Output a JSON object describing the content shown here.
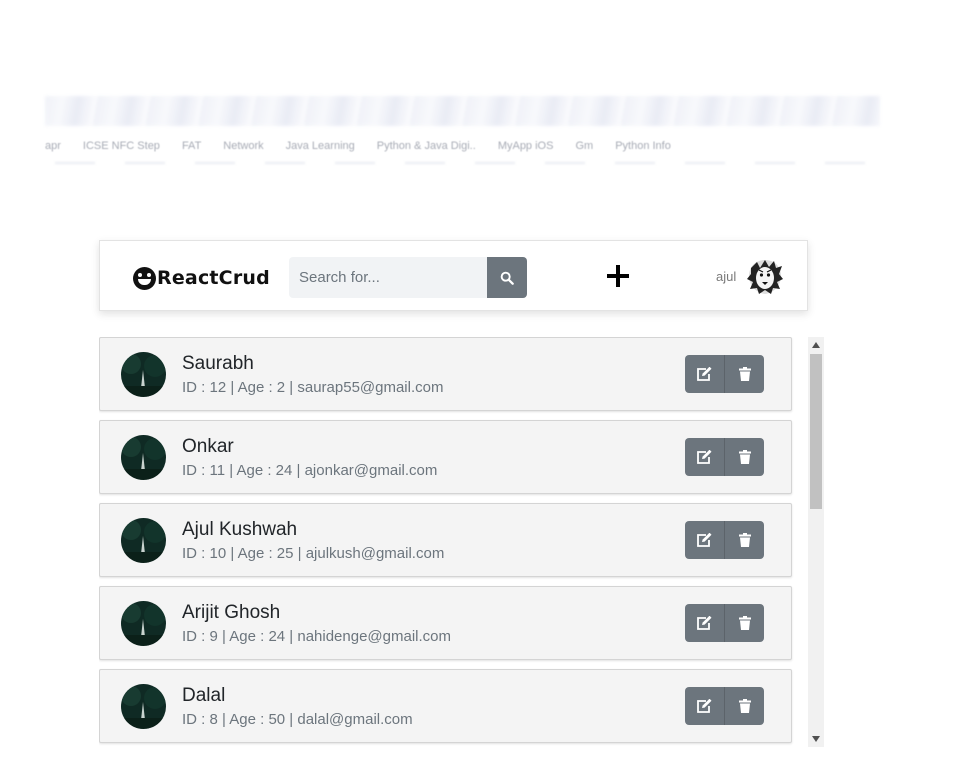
{
  "browser_chrome": {
    "bookmarks": [
      "apr",
      "ICSE NFC Step",
      "FAT",
      "Network",
      "Java Learning",
      "Python & Java Digi..",
      "MyApp iOS",
      "Gm",
      "Python Info"
    ]
  },
  "navbar": {
    "brand": "ReactCrud",
    "search_placeholder": "Search for...",
    "search_value": "",
    "add_icon": "plus-icon",
    "search_icon": "search-icon",
    "user_name": "ajul",
    "user_avatar": "lion-avatar"
  },
  "users": [
    {
      "name": "Saurabh",
      "meta": "ID : 12 | Age : 2 | saurap55@gmail.com"
    },
    {
      "name": "Onkar",
      "meta": "ID : 11 | Age : 24 | ajonkar@gmail.com"
    },
    {
      "name": "Ajul Kushwah",
      "meta": "ID : 10 | Age : 25 | ajulkush@gmail.com"
    },
    {
      "name": "Arijit Ghosh",
      "meta": "ID : 9 | Age : 24 | nahidenge@gmail.com"
    },
    {
      "name": "Dalal",
      "meta": "ID : 8 | Age : 50 | dalal@gmail.com"
    }
  ],
  "row_actions": {
    "edit_icon": "edit-icon",
    "delete_icon": "trash-icon"
  },
  "colors": {
    "button_gray": "#6c757d",
    "card_bg": "#f4f4f4",
    "input_bg": "#f1f3f5",
    "avatar_dark": "#0f2a24"
  }
}
